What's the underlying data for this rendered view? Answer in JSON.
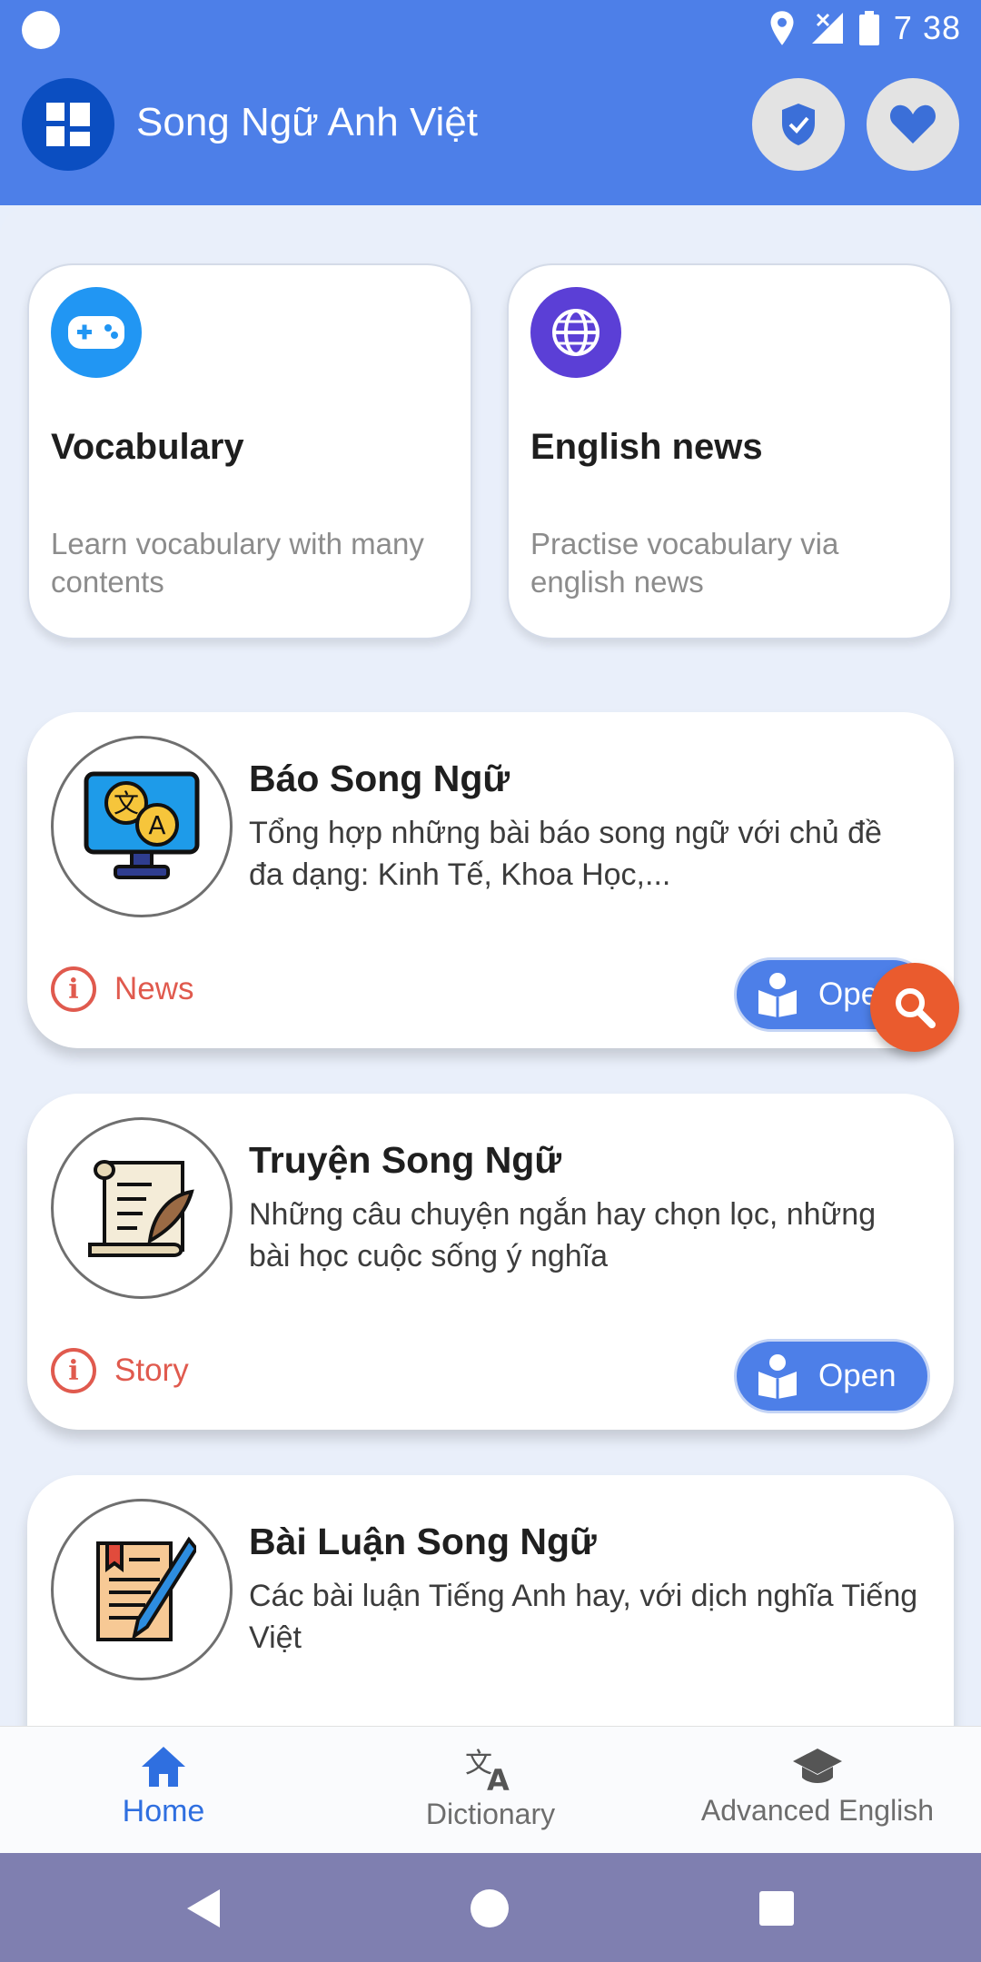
{
  "status_bar": {
    "time": "7 38"
  },
  "header": {
    "title": "Song Ngữ Anh Việt",
    "logo_icon": "dashboard-icon",
    "shield_icon": "shield-check-icon",
    "heart_icon": "heart-icon"
  },
  "features": [
    {
      "title": "Vocabulary",
      "desc": "Learn vocabulary with many contents",
      "icon": "gamepad-icon",
      "icon_color": "#2196f3"
    },
    {
      "title": "English news",
      "desc": "Practise vocabulary via english news",
      "icon": "globe-icon",
      "icon_color": "#5b3fd6"
    }
  ],
  "cards": [
    {
      "title": "Báo Song Ngữ",
      "desc": "Tổng hợp những bài báo song ngữ với chủ đề đa dạng: Kinh Tế, Khoa Học,...",
      "tag": "News",
      "button": "Open",
      "icon": "translate-monitor-icon"
    },
    {
      "title": "Truyện Song Ngữ",
      "desc": "Những câu chuyện ngắn hay chọn lọc, những bài học cuộc sống ý nghĩa",
      "tag": "Story",
      "button": "Open",
      "icon": "scroll-quill-icon"
    },
    {
      "title": "Bài Luận Song Ngữ",
      "desc": "Các bài luận Tiếng Anh hay, với dịch nghĩa Tiếng Việt",
      "tag": "",
      "button": "",
      "icon": "document-pen-icon"
    }
  ],
  "bottom_nav": {
    "home": "Home",
    "dictionary": "Dictionary",
    "advanced": "Advanced English"
  },
  "colors": {
    "primary": "#4d7fe8",
    "accent_orange": "#ea5b2e",
    "tag_red": "#e05a4e",
    "nav_bar": "#7f7fb0"
  }
}
